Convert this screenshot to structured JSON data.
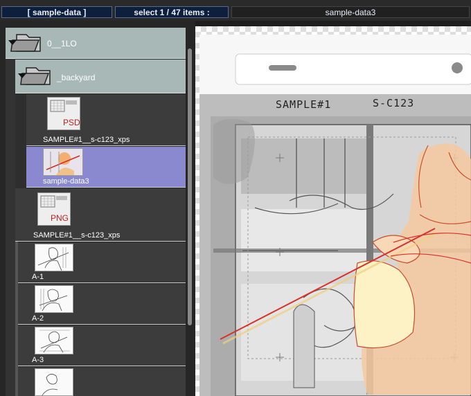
{
  "header": {
    "path_label": "[ sample-data ]",
    "selection_label": "select 1 / 47 items :",
    "file_title": "sample-data3"
  },
  "tree": {
    "root_folder": {
      "label": "0__1LO"
    },
    "sub_folder": {
      "label": "_backyard"
    },
    "items": [
      {
        "label": "SAMPLE#1__s-c123_xps",
        "badge": "PSD"
      },
      {
        "label": "sample-data3",
        "selected": true
      },
      {
        "label": "SAMPLE#1__s-c123_xps",
        "badge": "PNG"
      },
      {
        "label": "A-1"
      },
      {
        "label": "A-2"
      },
      {
        "label": "A-3"
      }
    ]
  },
  "canvas": {
    "sample_number": "SAMPLE#1",
    "scene_code": "S-C123"
  },
  "colors": {
    "folder_bg": "#a7b8b6",
    "selected_bg": "#8a88cf",
    "header_bg": "#0d1f3c",
    "sketch_red": "#d8302a",
    "skin": "#f6c9a0"
  }
}
